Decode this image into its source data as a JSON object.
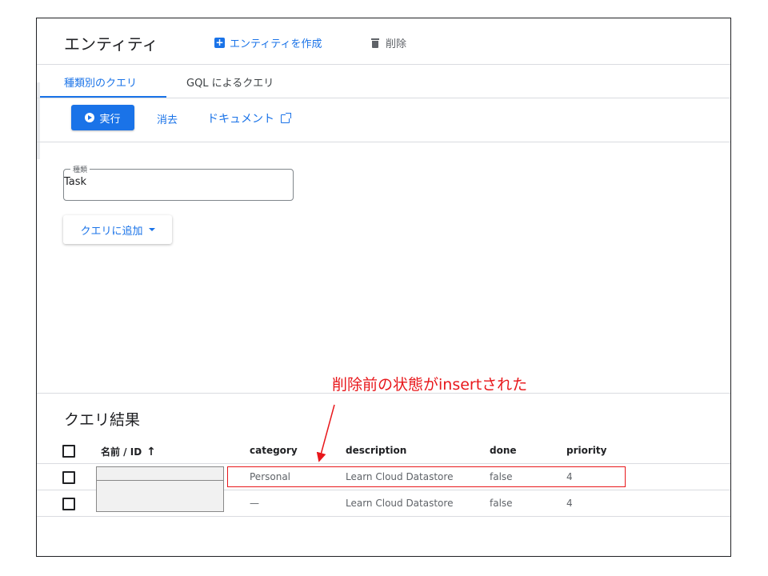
{
  "header": {
    "title": "エンティティ",
    "create_label": "エンティティを作成",
    "delete_label": "削除"
  },
  "tabs": [
    {
      "label": "種類別のクエリ",
      "active": true
    },
    {
      "label": "GQL によるクエリ",
      "active": false
    }
  ],
  "toolbar": {
    "run_label": "実行",
    "clear_label": "消去",
    "docs_label": "ドキュメント"
  },
  "kind_field": {
    "label": "種類",
    "value": "Task"
  },
  "add_query_label": "クエリに追加",
  "results": {
    "title": "クエリ結果",
    "columns": [
      "名前 / ID",
      "category",
      "description",
      "done",
      "priority"
    ],
    "rows": [
      {
        "name": "",
        "category": "Personal",
        "description": "Learn Cloud Datastore",
        "done": "false",
        "priority": "4"
      },
      {
        "name": "",
        "category": "—",
        "description": "Learn Cloud Datastore",
        "done": "false",
        "priority": "4"
      }
    ]
  },
  "annotation": {
    "text": "削除前の状態がinsertされた",
    "color": "#e8171b"
  },
  "colors": {
    "accent": "#1a73e8",
    "annotation": "#e8171b"
  }
}
